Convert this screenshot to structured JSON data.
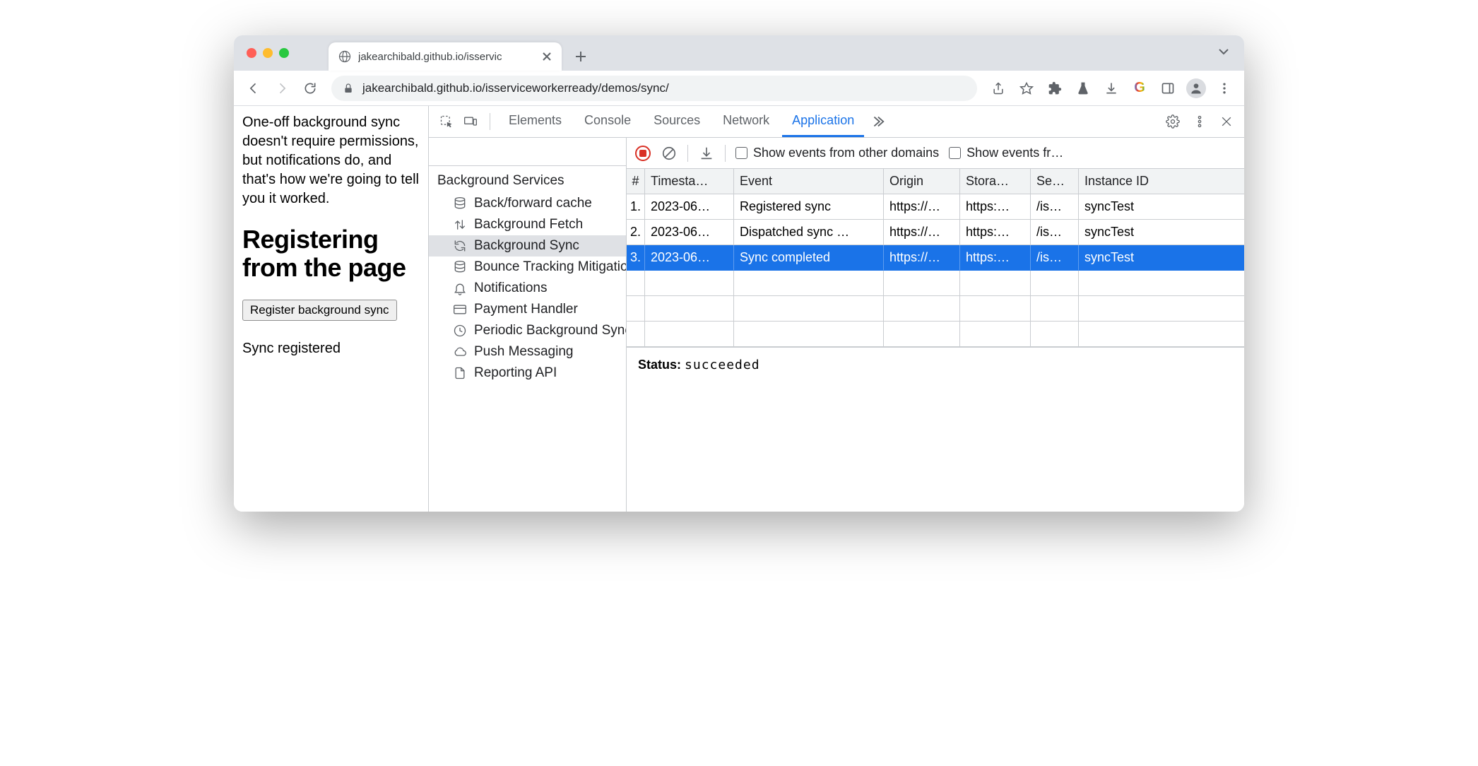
{
  "tab": {
    "title": "jakearchibald.github.io/isservic"
  },
  "url": "jakearchibald.github.io/isserviceworkerready/demos/sync/",
  "page": {
    "paragraph": "One-off background sync doesn't require permissions, but notifications do, and that's how we're going to tell you it worked.",
    "heading": "Registering from the page",
    "button": "Register background sync",
    "status": "Sync registered"
  },
  "devtools": {
    "tabs": [
      "Elements",
      "Console",
      "Sources",
      "Network",
      "Application"
    ],
    "active_tab": "Application",
    "sidebar": {
      "section": "Background Services",
      "items": [
        {
          "label": "Back/forward cache",
          "icon": "database"
        },
        {
          "label": "Background Fetch",
          "icon": "updown"
        },
        {
          "label": "Background Sync",
          "icon": "sync",
          "selected": true
        },
        {
          "label": "Bounce Tracking Mitigations",
          "icon": "database"
        },
        {
          "label": "Notifications",
          "icon": "bell"
        },
        {
          "label": "Payment Handler",
          "icon": "card"
        },
        {
          "label": "Periodic Background Sync",
          "icon": "clock"
        },
        {
          "label": "Push Messaging",
          "icon": "cloud"
        },
        {
          "label": "Reporting API",
          "icon": "file"
        }
      ]
    },
    "event_toolbar": {
      "show_other_domains": "Show events from other domains",
      "show_events_fr": "Show events fr…"
    },
    "table": {
      "columns": [
        "#",
        "Timesta…",
        "Event",
        "Origin",
        "Stora…",
        "Se…",
        "Instance ID"
      ],
      "rows": [
        {
          "n": "1.",
          "ts": "2023-06…",
          "ev": "Registered sync",
          "or": "https://…",
          "st": "https:…",
          "sc": "/is…",
          "id": "syncTest"
        },
        {
          "n": "2.",
          "ts": "2023-06…",
          "ev": "Dispatched sync …",
          "or": "https://…",
          "st": "https:…",
          "sc": "/is…",
          "id": "syncTest"
        },
        {
          "n": "3.",
          "ts": "2023-06…",
          "ev": "Sync completed",
          "or": "https://…",
          "st": "https:…",
          "sc": "/is…",
          "id": "syncTest",
          "selected": true
        }
      ]
    },
    "detail": {
      "label": "Status:",
      "value": "succeeded"
    }
  }
}
